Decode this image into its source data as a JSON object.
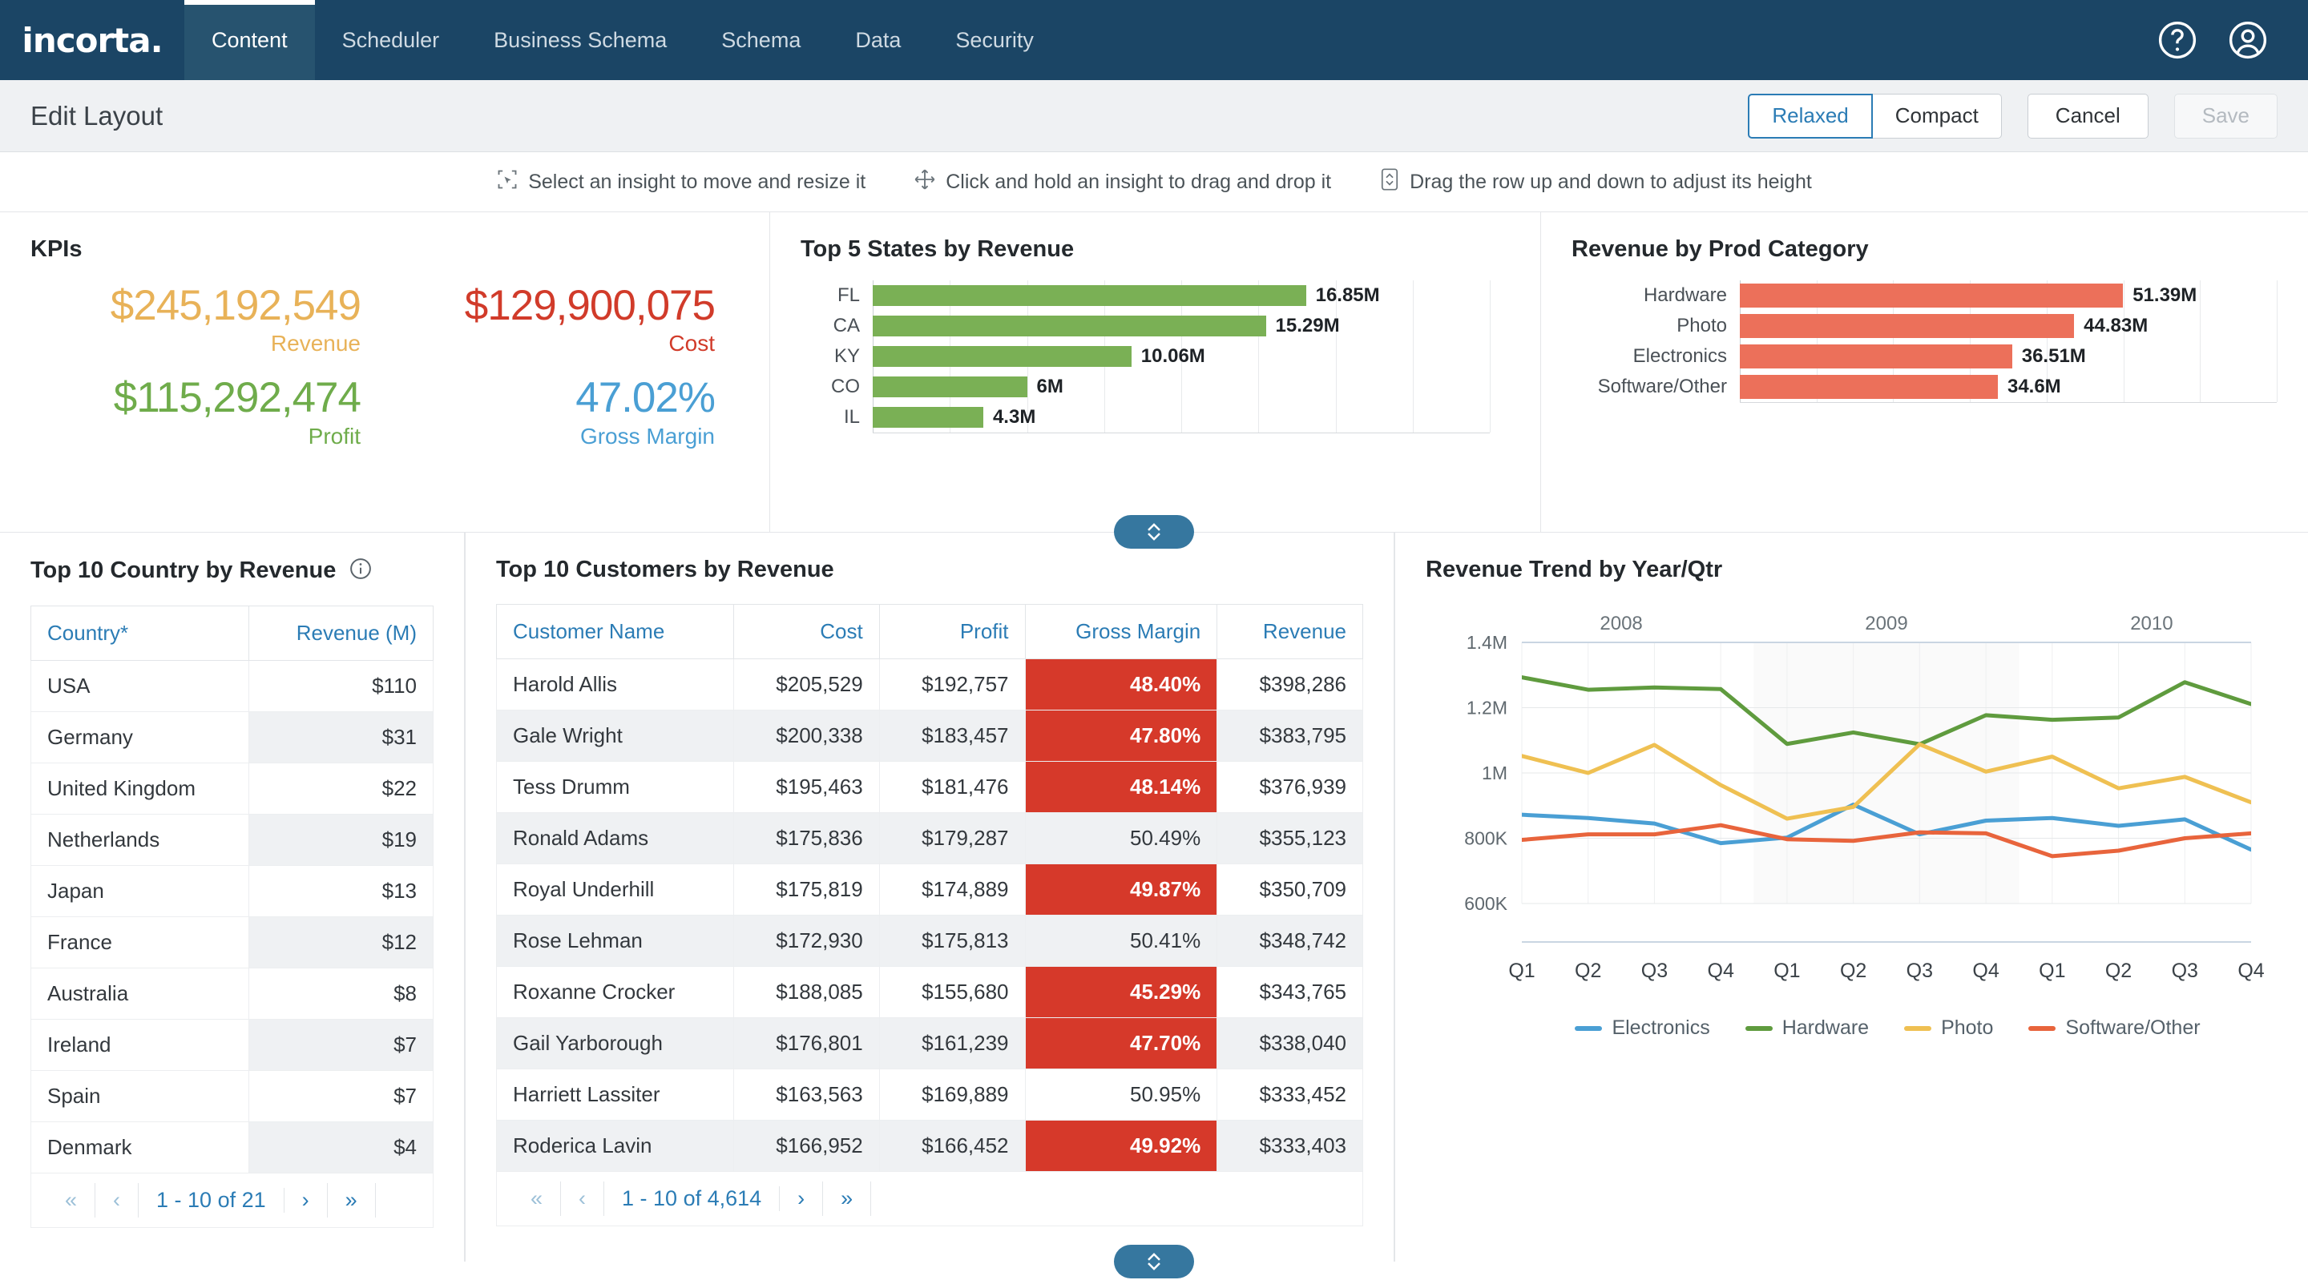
{
  "nav": {
    "logo": "incorta.",
    "items": [
      {
        "label": "Content",
        "active": true
      },
      {
        "label": "Scheduler",
        "active": false
      },
      {
        "label": "Business Schema",
        "active": false
      },
      {
        "label": "Schema",
        "active": false
      },
      {
        "label": "Data",
        "active": false
      },
      {
        "label": "Security",
        "active": false
      }
    ],
    "help_icon": "help-circle-icon",
    "account_icon": "user-circle-icon"
  },
  "header": {
    "title": "Edit Layout",
    "density": {
      "relaxed": "Relaxed",
      "compact": "Compact",
      "selected": "Relaxed"
    },
    "cancel": "Cancel",
    "save": "Save"
  },
  "hints": [
    {
      "icon": "select-resize-icon",
      "text": "Select an insight to move and resize it"
    },
    {
      "icon": "move-arrows-icon",
      "text": "Click and hold an insight to drag and drop it"
    },
    {
      "icon": "row-height-icon",
      "text": "Drag the row up and down to adjust its height"
    }
  ],
  "kpis": {
    "title": "KPIs",
    "items": [
      {
        "value": "$245,192,549",
        "label": "Revenue",
        "color": "#e8b258"
      },
      {
        "value": "$129,900,075",
        "label": "Cost",
        "color": "#d13b2a"
      },
      {
        "value": "$115,292,474",
        "label": "Profit",
        "color": "#6fac4b"
      },
      {
        "value": "47.02%",
        "label": "Gross Margin",
        "color": "#4a9fd4"
      }
    ]
  },
  "states_chart": {
    "title": "Top 5 States by Revenue"
  },
  "prod_chart": {
    "title": "Revenue by Prod Category"
  },
  "country_table": {
    "title": "Top 10 Country by Revenue",
    "info_icon": "info-circle-icon",
    "columns": [
      "Country*",
      "Revenue (M)"
    ],
    "rows": [
      [
        "USA",
        "$110"
      ],
      [
        "Germany",
        "$31"
      ],
      [
        "United Kingdom",
        "$22"
      ],
      [
        "Netherlands",
        "$19"
      ],
      [
        "Japan",
        "$13"
      ],
      [
        "France",
        "$12"
      ],
      [
        "Australia",
        "$8"
      ],
      [
        "Ireland",
        "$7"
      ],
      [
        "Spain",
        "$7"
      ],
      [
        "Denmark",
        "$4"
      ]
    ],
    "pager": {
      "first": "«",
      "prev": "‹",
      "label": "1 - 10 of 21",
      "next": "›",
      "last": "»"
    }
  },
  "customers_table": {
    "title": "Top 10 Customers by Revenue",
    "columns": [
      "Customer Name",
      "Cost",
      "Profit",
      "Gross Margin",
      "Revenue"
    ],
    "rows": [
      {
        "name": "Harold Allis",
        "cost": "$205,529",
        "profit": "$192,757",
        "margin": "48.40%",
        "margin_flag": true,
        "revenue": "$398,286"
      },
      {
        "name": "Gale Wright",
        "cost": "$200,338",
        "profit": "$183,457",
        "margin": "47.80%",
        "margin_flag": true,
        "revenue": "$383,795"
      },
      {
        "name": "Tess Drumm",
        "cost": "$195,463",
        "profit": "$181,476",
        "margin": "48.14%",
        "margin_flag": true,
        "revenue": "$376,939"
      },
      {
        "name": "Ronald Adams",
        "cost": "$175,836",
        "profit": "$179,287",
        "margin": "50.49%",
        "margin_flag": false,
        "revenue": "$355,123"
      },
      {
        "name": "Royal Underhill",
        "cost": "$175,819",
        "profit": "$174,889",
        "margin": "49.87%",
        "margin_flag": true,
        "revenue": "$350,709"
      },
      {
        "name": "Rose Lehman",
        "cost": "$172,930",
        "profit": "$175,813",
        "margin": "50.41%",
        "margin_flag": false,
        "revenue": "$348,742"
      },
      {
        "name": "Roxanne Crocker",
        "cost": "$188,085",
        "profit": "$155,680",
        "margin": "45.29%",
        "margin_flag": true,
        "revenue": "$343,765"
      },
      {
        "name": "Gail Yarborough",
        "cost": "$176,801",
        "profit": "$161,239",
        "margin": "47.70%",
        "margin_flag": true,
        "revenue": "$338,040"
      },
      {
        "name": "Harriett Lassiter",
        "cost": "$163,563",
        "profit": "$169,889",
        "margin": "50.95%",
        "margin_flag": false,
        "revenue": "$333,452"
      },
      {
        "name": "Roderica Lavin",
        "cost": "$166,952",
        "profit": "$166,452",
        "margin": "49.92%",
        "margin_flag": true,
        "revenue": "$333,403"
      }
    ],
    "pager": {
      "first": "«",
      "prev": "‹",
      "label": "1 - 10 of 4,614",
      "next": "›",
      "last": "»"
    }
  },
  "trend_chart": {
    "title": "Revenue Trend by Year/Qtr"
  },
  "chart_data": [
    {
      "type": "bar",
      "orientation": "horizontal",
      "title": "Top 5 States by Revenue",
      "categories": [
        "FL",
        "CA",
        "KY",
        "CO",
        "IL"
      ],
      "values": [
        16.85,
        15.29,
        10.06,
        6.0,
        4.3
      ],
      "labels": [
        "16.85M",
        "15.29M",
        "10.06M",
        "6M",
        "4.3M"
      ],
      "color": "#7ab055",
      "xlabel": "",
      "ylabel": "",
      "xlim": [
        0,
        24
      ],
      "grid": true,
      "gridline_count": 8,
      "legend": "none"
    },
    {
      "type": "bar",
      "orientation": "horizontal",
      "title": "Revenue by Prod Category",
      "categories": [
        "Hardware",
        "Photo",
        "Electronics",
        "Software/Other"
      ],
      "values": [
        51.39,
        44.83,
        36.51,
        34.6
      ],
      "labels": [
        "51.39M",
        "44.83M",
        "36.51M",
        "34.6M"
      ],
      "color": "#ec705a",
      "xlabel": "",
      "ylabel": "",
      "xlim": [
        0,
        72
      ],
      "grid": true,
      "gridline_count": 7,
      "legend": "none"
    },
    {
      "type": "line",
      "title": "Revenue Trend by Year/Qtr",
      "xlabel": "",
      "ylabel": "",
      "x": [
        "Q1",
        "Q2",
        "Q3",
        "Q4",
        "Q1",
        "Q2",
        "Q3",
        "Q4",
        "Q1",
        "Q2",
        "Q3",
        "Q4"
      ],
      "x_groups": [
        {
          "label": "2008",
          "span": 4
        },
        {
          "label": "2009",
          "span": 4
        },
        {
          "label": "2010",
          "span": 4
        }
      ],
      "ylim": [
        600000,
        1400000
      ],
      "yticks": [
        600000,
        800000,
        1000000,
        1200000,
        1400000
      ],
      "ytick_labels": [
        "600K",
        "800K",
        "1M",
        "1.2M",
        "1.4M"
      ],
      "grid": true,
      "legend_position": "bottom",
      "series": [
        {
          "name": "Electronics",
          "color": "#4a9fd4",
          "values": [
            872000,
            862000,
            845000,
            785000,
            802000,
            903000,
            812000,
            854000,
            862000,
            838000,
            858000,
            765000
          ]
        },
        {
          "name": "Hardware",
          "color": "#5f9b3e",
          "values": [
            1293000,
            1255000,
            1262000,
            1257000,
            1089000,
            1124000,
            1088000,
            1177000,
            1163000,
            1170000,
            1278000,
            1211000
          ]
        },
        {
          "name": "Photo",
          "color": "#efc052",
          "values": [
            1052000,
            1000000,
            1086000,
            963000,
            860000,
            896000,
            1088000,
            1004000,
            1050000,
            953000,
            988000,
            910000
          ]
        },
        {
          "name": "Software/Other",
          "color": "#e8643c",
          "values": [
            795000,
            812000,
            812000,
            840000,
            797000,
            792000,
            818000,
            815000,
            745000,
            762000,
            800000,
            815000
          ]
        }
      ]
    }
  ]
}
